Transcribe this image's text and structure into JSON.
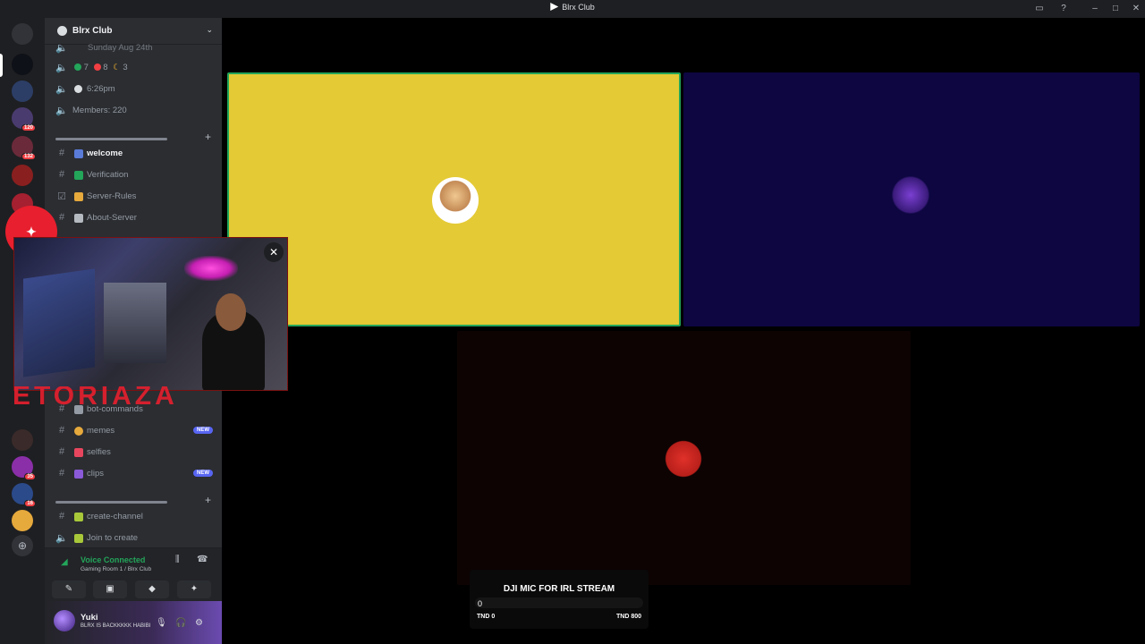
{
  "window": {
    "title": "Blrx Club"
  },
  "server": {
    "name": "Blrx Club"
  },
  "stats": {
    "date": "Sunday Aug 24th",
    "online": "7",
    "dnd": "8",
    "idle": "3",
    "time": "6:26pm",
    "members": "Members: 220"
  },
  "channels_top": [
    {
      "name": "welcome",
      "active": true
    },
    {
      "name": "Verification"
    },
    {
      "name": "Server-Rules"
    },
    {
      "name": "About-Server"
    }
  ],
  "channels_mid": [
    {
      "name": "bot-commands"
    },
    {
      "name": "memes",
      "badge": "NEW"
    },
    {
      "name": "selfies"
    },
    {
      "name": "clips",
      "badge": "NEW"
    }
  ],
  "channels_voice": [
    {
      "name": "create-channel"
    },
    {
      "name": "Join to create"
    }
  ],
  "guild_badges": [
    "120",
    "132",
    "35",
    "16"
  ],
  "voice": {
    "status": "Voice Connected",
    "location": "Gaming Room 1 / Blrx Club"
  },
  "user": {
    "name": "Yuki",
    "status": "BLRX IS BACKKKKK HABIBI"
  },
  "overlay": {
    "text": "ETORIAZA"
  },
  "goal": {
    "title": "DJI MIC FOR IRL STREAM",
    "current": "0",
    "min_label": "TND 0",
    "max_label": "TND 800",
    "progress": 0
  },
  "colors": {
    "tile_yellow": "#e4ca35",
    "tile_navy": "#0d0641",
    "tile_dark": "#0d0303",
    "speaking": "#23a55a",
    "accent": "#5865f2"
  }
}
